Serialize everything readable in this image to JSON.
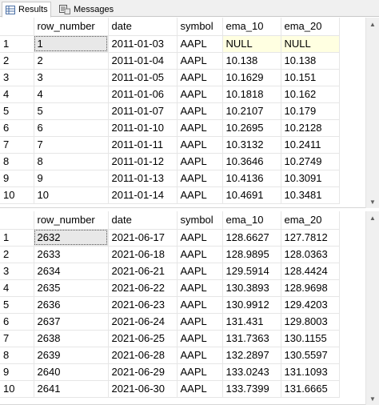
{
  "tabs": [
    {
      "label": "Results",
      "icon": "grid-icon"
    },
    {
      "label": "Messages",
      "icon": "message-icon"
    }
  ],
  "columns": [
    "row_number",
    "date",
    "symbol",
    "ema_10",
    "ema_20"
  ],
  "grid1": {
    "rows": [
      {
        "n": "1",
        "cells": [
          "1",
          "2011-01-03",
          "AAPL",
          "NULL",
          "NULL"
        ]
      },
      {
        "n": "2",
        "cells": [
          "2",
          "2011-01-04",
          "AAPL",
          "10.138",
          "10.138"
        ]
      },
      {
        "n": "3",
        "cells": [
          "3",
          "2011-01-05",
          "AAPL",
          "10.1629",
          "10.151"
        ]
      },
      {
        "n": "4",
        "cells": [
          "4",
          "2011-01-06",
          "AAPL",
          "10.1818",
          "10.162"
        ]
      },
      {
        "n": "5",
        "cells": [
          "5",
          "2011-01-07",
          "AAPL",
          "10.2107",
          "10.179"
        ]
      },
      {
        "n": "6",
        "cells": [
          "6",
          "2011-01-10",
          "AAPL",
          "10.2695",
          "10.2128"
        ]
      },
      {
        "n": "7",
        "cells": [
          "7",
          "2011-01-11",
          "AAPL",
          "10.3132",
          "10.2411"
        ]
      },
      {
        "n": "8",
        "cells": [
          "8",
          "2011-01-12",
          "AAPL",
          "10.3646",
          "10.2749"
        ]
      },
      {
        "n": "9",
        "cells": [
          "9",
          "2011-01-13",
          "AAPL",
          "10.4136",
          "10.3091"
        ]
      },
      {
        "n": "10",
        "cells": [
          "10",
          "2011-01-14",
          "AAPL",
          "10.4691",
          "10.3481"
        ]
      }
    ]
  },
  "grid2": {
    "rows": [
      {
        "n": "1",
        "cells": [
          "2632",
          "2021-06-17",
          "AAPL",
          "128.6627",
          "127.7812"
        ]
      },
      {
        "n": "2",
        "cells": [
          "2633",
          "2021-06-18",
          "AAPL",
          "128.9895",
          "128.0363"
        ]
      },
      {
        "n": "3",
        "cells": [
          "2634",
          "2021-06-21",
          "AAPL",
          "129.5914",
          "128.4424"
        ]
      },
      {
        "n": "4",
        "cells": [
          "2635",
          "2021-06-22",
          "AAPL",
          "130.3893",
          "128.9698"
        ]
      },
      {
        "n": "5",
        "cells": [
          "2636",
          "2021-06-23",
          "AAPL",
          "130.9912",
          "129.4203"
        ]
      },
      {
        "n": "6",
        "cells": [
          "2637",
          "2021-06-24",
          "AAPL",
          "131.431",
          "129.8003"
        ]
      },
      {
        "n": "7",
        "cells": [
          "2638",
          "2021-06-25",
          "AAPL",
          "131.7363",
          "130.1155"
        ]
      },
      {
        "n": "8",
        "cells": [
          "2639",
          "2021-06-28",
          "AAPL",
          "132.2897",
          "130.5597"
        ]
      },
      {
        "n": "9",
        "cells": [
          "2640",
          "2021-06-29",
          "AAPL",
          "133.0243",
          "131.1093"
        ]
      },
      {
        "n": "10",
        "cells": [
          "2641",
          "2021-06-30",
          "AAPL",
          "133.7399",
          "131.6665"
        ]
      }
    ]
  },
  "colors": {
    "null_cell": "#ffffe1",
    "selected_cell": "#e8e8e8"
  }
}
